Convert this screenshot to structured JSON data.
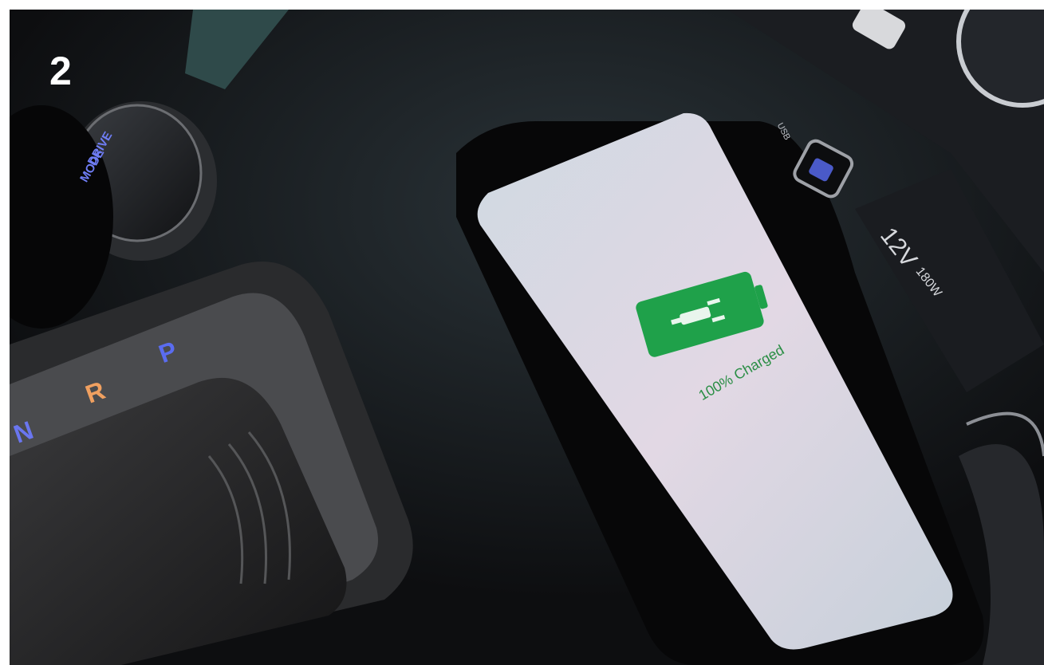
{
  "step_number": "2",
  "drive_mode": {
    "line1": "DRIVE",
    "line2": "MODE"
  },
  "gear_letters": {
    "park": "P",
    "reverse": "R",
    "neutral": "N"
  },
  "phone": {
    "charge_status": "100% Charged",
    "battery_color": "#1fa14a"
  },
  "ports": {
    "usb_label": "USB",
    "power_voltage": "12V",
    "power_watts": "180W"
  },
  "colors": {
    "console": "#0d0e10",
    "screen": "#d9d7e3",
    "gear_p": "#5a6cf0",
    "gear_r": "#f0a060",
    "gear_n": "#6a76f0"
  }
}
